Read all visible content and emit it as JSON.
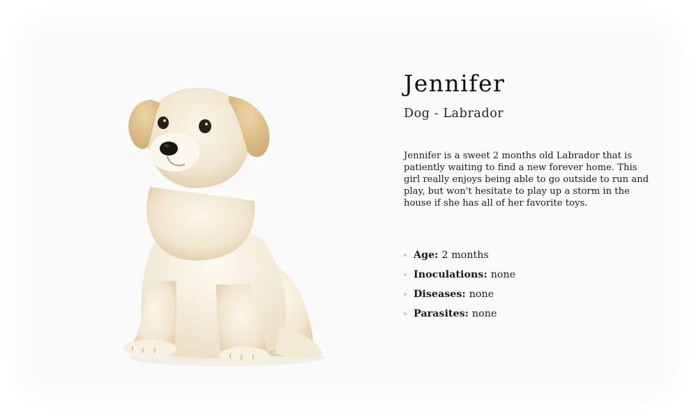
{
  "pet": {
    "name": "Jennifer",
    "subtitle": "Dog - Labrador",
    "description": "Jennifer is a sweet 2 months old Labrador that is patiently waiting to find a new forever home. This girl really enjoys being able to go outside to run and play, but won't hesitate to play up a storm in the house if she has all of her favorite toys.",
    "photo_icon": "puppy-photo",
    "facts": [
      {
        "label": "Age:",
        "value": "2 months"
      },
      {
        "label": "Inoculations:",
        "value": "none"
      },
      {
        "label": "Diseases:",
        "value": "none"
      },
      {
        "label": "Parasites:",
        "value": "none"
      }
    ]
  },
  "colors": {
    "card_bg": "#fafafa",
    "bullet": "#e7c3ab",
    "text": "#1a1a1a"
  }
}
